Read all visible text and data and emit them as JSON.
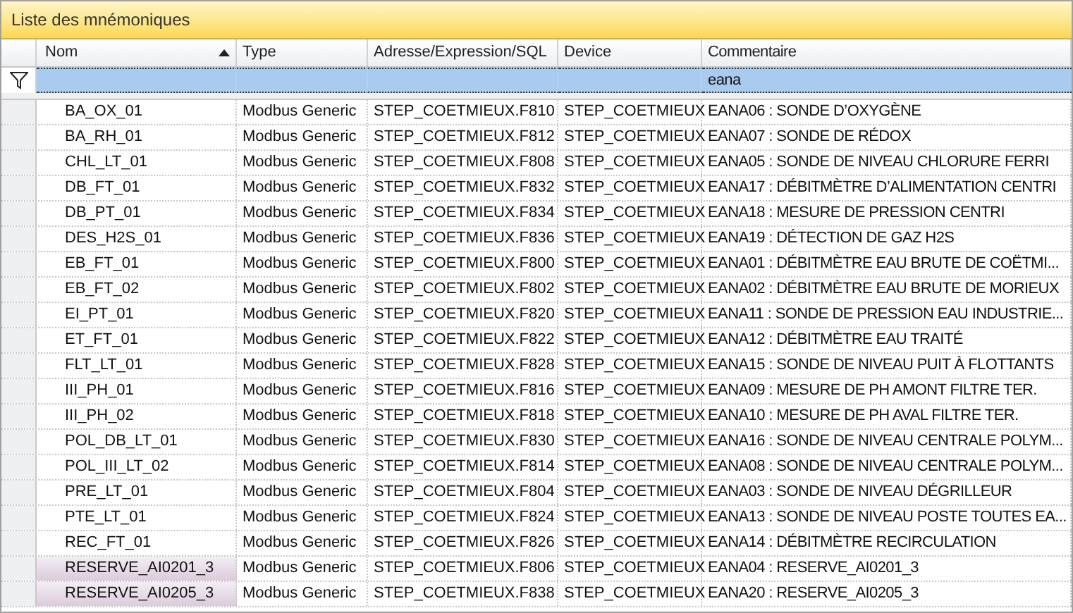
{
  "panel": {
    "title": "Liste des mnémoniques"
  },
  "table": {
    "columns": [
      {
        "label": "Nom",
        "sorted_ascending": true
      },
      {
        "label": "Type",
        "sorted_ascending": false
      },
      {
        "label": "Adresse/Expression/SQL",
        "sorted_ascending": false
      },
      {
        "label": "Device",
        "sorted_ascending": false
      },
      {
        "label": "Commentaire",
        "sorted_ascending": false,
        "filter": "eana"
      }
    ],
    "rows": [
      {
        "cells": [
          "BA_OX_01",
          "Modbus Generic",
          "STEP_COETMIEUX.F810",
          "STEP_COETMIEUX",
          "EANA06 : SONDE D’OXYGÈNE"
        ],
        "highlighted": false
      },
      {
        "cells": [
          "BA_RH_01",
          "Modbus Generic",
          "STEP_COETMIEUX.F812",
          "STEP_COETMIEUX",
          "EANA07 : SONDE DE RÉDOX"
        ],
        "highlighted": false
      },
      {
        "cells": [
          "CHL_LT_01",
          "Modbus Generic",
          "STEP_COETMIEUX.F808",
          "STEP_COETMIEUX",
          "EANA05 : SONDE DE NIVEAU CHLORURE FERRI"
        ],
        "highlighted": false
      },
      {
        "cells": [
          "DB_FT_01",
          "Modbus Generic",
          "STEP_COETMIEUX.F832",
          "STEP_COETMIEUX",
          "EANA17 : DÉBITMÈTRE D’ALIMENTATION CENTRI"
        ],
        "highlighted": false
      },
      {
        "cells": [
          "DB_PT_01",
          "Modbus Generic",
          "STEP_COETMIEUX.F834",
          "STEP_COETMIEUX",
          "EANA18 : MESURE DE PRESSION CENTRI"
        ],
        "highlighted": false
      },
      {
        "cells": [
          "DES_H2S_01",
          "Modbus Generic",
          "STEP_COETMIEUX.F836",
          "STEP_COETMIEUX",
          "EANA19 : DÉTECTION DE GAZ H2S"
        ],
        "highlighted": false
      },
      {
        "cells": [
          "EB_FT_01",
          "Modbus Generic",
          "STEP_COETMIEUX.F800",
          "STEP_COETMIEUX",
          "EANA01 : DÉBITMÈTRE EAU BRUTE DE COËTMI..."
        ],
        "highlighted": false
      },
      {
        "cells": [
          "EB_FT_02",
          "Modbus Generic",
          "STEP_COETMIEUX.F802",
          "STEP_COETMIEUX",
          "EANA02 : DÉBITMÈTRE EAU BRUTE DE MORIEUX"
        ],
        "highlighted": false
      },
      {
        "cells": [
          "EI_PT_01",
          "Modbus Generic",
          "STEP_COETMIEUX.F820",
          "STEP_COETMIEUX",
          "EANA11 : SONDE DE PRESSION EAU INDUSTRIE..."
        ],
        "highlighted": false
      },
      {
        "cells": [
          "ET_FT_01",
          "Modbus Generic",
          "STEP_COETMIEUX.F822",
          "STEP_COETMIEUX",
          "EANA12 : DÉBITMÈTRE EAU TRAITÉ"
        ],
        "highlighted": false
      },
      {
        "cells": [
          "FLT_LT_01",
          "Modbus Generic",
          "STEP_COETMIEUX.F828",
          "STEP_COETMIEUX",
          "EANA15 : SONDE DE NIVEAU PUIT À FLOTTANTS"
        ],
        "highlighted": false
      },
      {
        "cells": [
          "III_PH_01",
          "Modbus Generic",
          "STEP_COETMIEUX.F816",
          "STEP_COETMIEUX",
          "EANA09 : MESURE DE PH AMONT FILTRE TER."
        ],
        "highlighted": false
      },
      {
        "cells": [
          "III_PH_02",
          "Modbus Generic",
          "STEP_COETMIEUX.F818",
          "STEP_COETMIEUX",
          "EANA10 : MESURE DE PH AVAL FILTRE TER."
        ],
        "highlighted": false
      },
      {
        "cells": [
          "POL_DB_LT_01",
          "Modbus Generic",
          "STEP_COETMIEUX.F830",
          "STEP_COETMIEUX",
          "EANA16 : SONDE DE NIVEAU CENTRALE POLYM..."
        ],
        "highlighted": false
      },
      {
        "cells": [
          "POL_III_LT_02",
          "Modbus Generic",
          "STEP_COETMIEUX.F814",
          "STEP_COETMIEUX",
          "EANA08 : SONDE DE NIVEAU CENTRALE POLYM..."
        ],
        "highlighted": false
      },
      {
        "cells": [
          "PRE_LT_01",
          "Modbus Generic",
          "STEP_COETMIEUX.F804",
          "STEP_COETMIEUX",
          "EANA03 : SONDE DE NIVEAU DÉGRILLEUR"
        ],
        "highlighted": false
      },
      {
        "cells": [
          "PTE_LT_01",
          "Modbus Generic",
          "STEP_COETMIEUX.F824",
          "STEP_COETMIEUX",
          "EANA13 : SONDE DE NIVEAU POSTE TOUTES EA..."
        ],
        "highlighted": false
      },
      {
        "cells": [
          "REC_FT_01",
          "Modbus Generic",
          "STEP_COETMIEUX.F826",
          "STEP_COETMIEUX",
          "EANA14 : DÉBITMÈTRE RECIRCULATION"
        ],
        "highlighted": false
      },
      {
        "cells": [
          "RESERVE_AI0201_3",
          "Modbus Generic",
          "STEP_COETMIEUX.F806",
          "STEP_COETMIEUX",
          "EANA04 : RESERVE_AI0201_3"
        ],
        "highlighted": true
      },
      {
        "cells": [
          "RESERVE_AI0205_3",
          "Modbus Generic",
          "STEP_COETMIEUX.F838",
          "STEP_COETMIEUX",
          "EANA20 : RESERVE_AI0205_3"
        ],
        "highlighted": true
      }
    ]
  }
}
